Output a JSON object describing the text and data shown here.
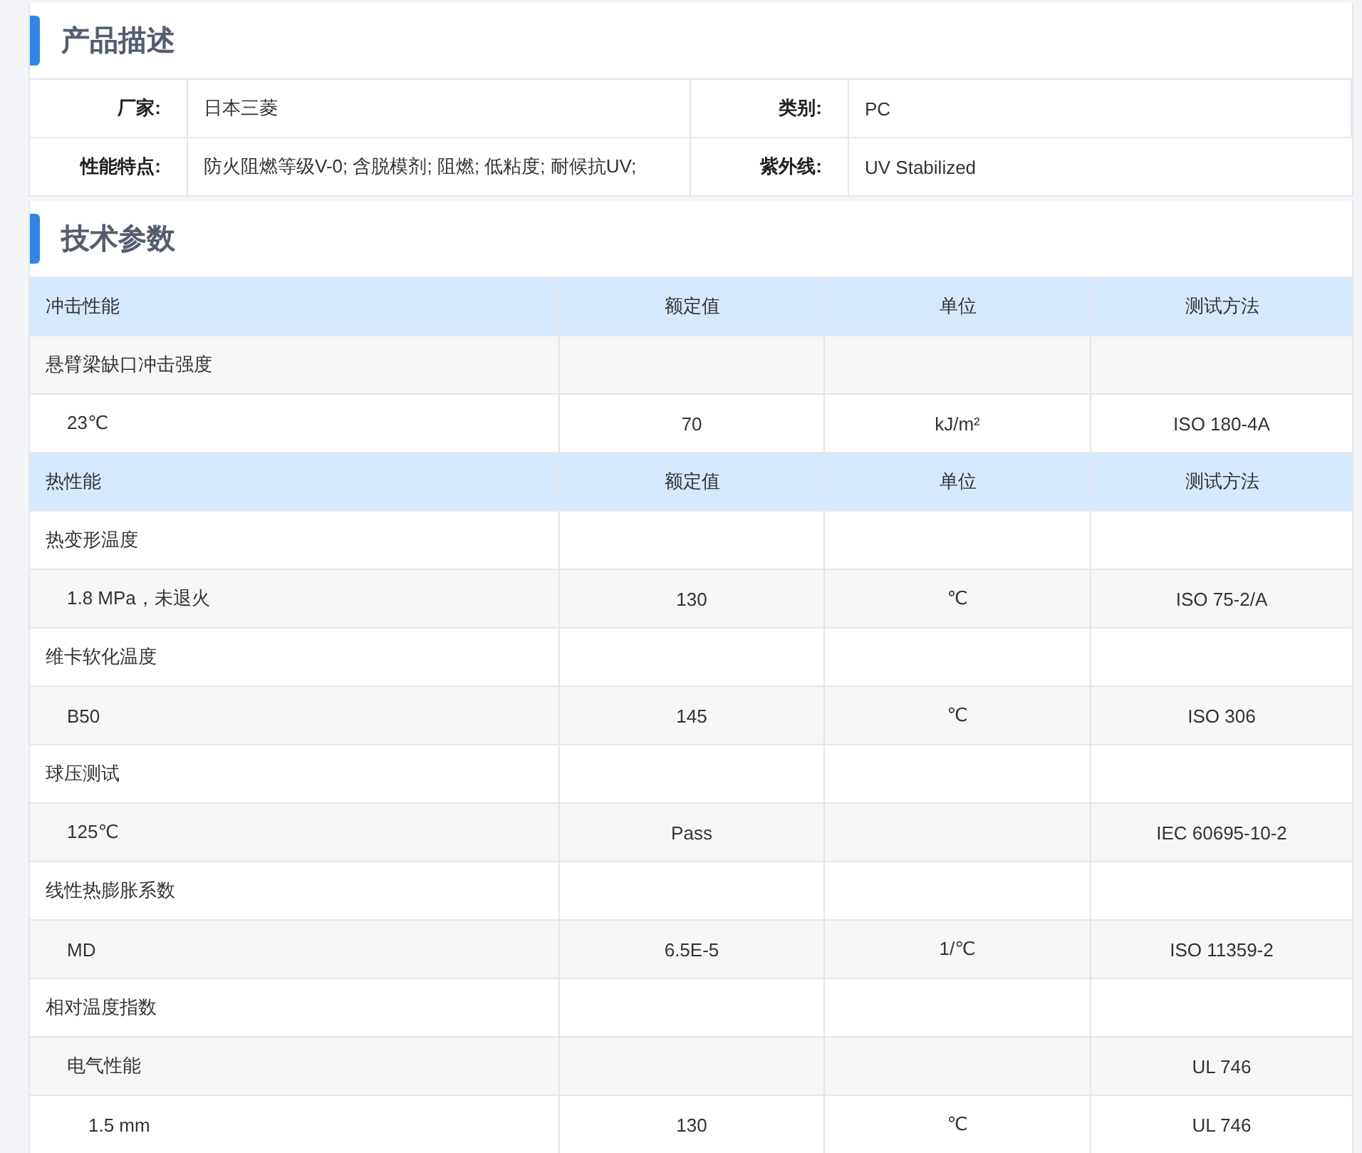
{
  "sections": [
    {
      "kind": "description",
      "title": "产品描述",
      "rows": [
        {
          "cells": [
            {
              "label": "厂家:",
              "value": "日本三菱"
            },
            {
              "label": "类别:",
              "value": "PC"
            }
          ]
        },
        {
          "cells": [
            {
              "label": "性能特点:",
              "value": "防火阻燃等级V-0; 含脱模剂; 阻燃; 低粘度; 耐候抗UV;"
            },
            {
              "label": "紫外线:",
              "value": "UV Stabilized"
            }
          ]
        }
      ]
    },
    {
      "kind": "parameters",
      "title": "技术参数",
      "groups": [
        {
          "header": [
            "冲击性能",
            "额定值",
            "单位",
            "测试方法"
          ],
          "rows": [
            {
              "cells": [
                "悬臂梁缺口冲击强度",
                "",
                "",
                ""
              ],
              "children": [
                {
                  "cells": [
                    "23℃",
                    "70",
                    "kJ/m²",
                    "ISO 180-4A"
                  ]
                }
              ]
            }
          ]
        },
        {
          "header": [
            "热性能",
            "额定值",
            "单位",
            "测试方法"
          ],
          "rows": [
            {
              "cells": [
                "热变形温度",
                "",
                "",
                ""
              ],
              "children": [
                {
                  "cells": [
                    "1.8 MPa，未退火",
                    "130",
                    "℃",
                    "ISO 75-2/A"
                  ]
                }
              ]
            },
            {
              "cells": [
                "维卡软化温度",
                "",
                "",
                ""
              ],
              "children": [
                {
                  "cells": [
                    "B50",
                    "145",
                    "℃",
                    "ISO 306"
                  ]
                }
              ]
            },
            {
              "cells": [
                "球压测试",
                "",
                "",
                ""
              ],
              "children": [
                {
                  "cells": [
                    "125℃",
                    "Pass",
                    "",
                    "IEC 60695-10-2"
                  ]
                }
              ]
            },
            {
              "cells": [
                "线性热膨胀系数",
                "",
                "",
                ""
              ],
              "children": [
                {
                  "cells": [
                    "MD",
                    "6.5E-5",
                    "1/℃",
                    "ISO 11359-2"
                  ]
                }
              ]
            },
            {
              "cells": [
                "相对温度指数",
                "",
                "",
                ""
              ],
              "children": [
                {
                  "cells": [
                    "电气性能",
                    "",
                    "",
                    "UL 746"
                  ],
                  "children": [
                    {
                      "cells": [
                        "1.5 mm",
                        "130",
                        "℃",
                        "UL 746"
                      ]
                    }
                  ]
                }
              ]
            }
          ]
        }
      ]
    }
  ]
}
